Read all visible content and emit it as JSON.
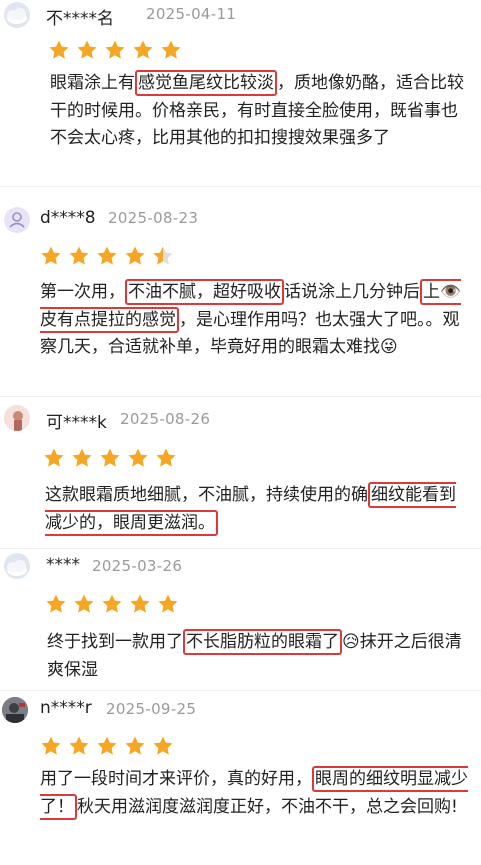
{
  "reviews": [
    {
      "user": "不****名",
      "date": "2025-04-11",
      "rating": 5,
      "text_before": "眼霜涂上有",
      "highlight": "感觉鱼尾纹比较淡",
      "text_after": "，质地像奶酪，适合比较干的时候用。价格亲民，有时直接全脸使用，既省事也不会太心疼，比用其他的扣扣搜搜效果强多了"
    },
    {
      "user": "d****8",
      "date": "2025-08-23",
      "rating": 4.5,
      "text_before": "第一次用，",
      "highlight": "不油不腻，超好吸收",
      "text_middle": "话说涂上几分钟后",
      "highlight2": "上👁️皮有点提拉的感觉",
      "text_after": "，是心理作用吗？也太强大了吧。。观察几天，合适就补单，毕竟好用的眼霜太难找😜"
    },
    {
      "user": "可****k",
      "date": "2025-08-26",
      "rating": 5,
      "text_before": "这款眼霜质地细腻，不油腻，持续使用的确",
      "highlight": "细纹能看到减少的，眼周更滋润。",
      "text_after": ""
    },
    {
      "user": "****",
      "date": "2025-03-26",
      "rating": 5,
      "text_before": "终于找到一款用了",
      "highlight": "不长脂肪粒的眼霜了",
      "text_after": "😥抹开之后很清爽保湿"
    },
    {
      "user": "n****r",
      "date": "2025-09-25",
      "rating": 5,
      "text_before": "用了一段时间才来评价，真的好用，",
      "highlight": "眼周的细纹明显减少了！",
      "text_after": "秋天用滋润度滋润度正好，不油不干，总之会回购!"
    }
  ],
  "colors": {
    "star": "#f5a623",
    "highlight_border": "#d93a3a",
    "date": "#9a9a9a"
  }
}
